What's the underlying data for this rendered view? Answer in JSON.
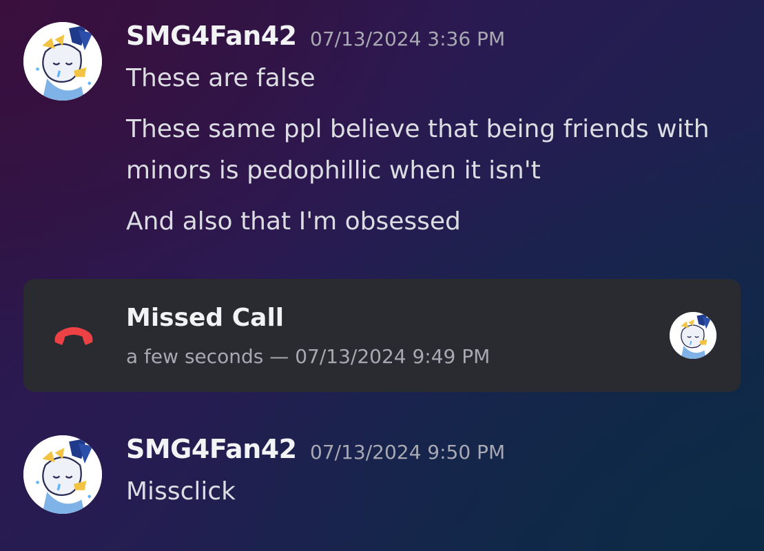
{
  "messages": [
    {
      "username": "SMG4Fan42",
      "timestamp": "07/13/2024 3:36 PM",
      "lines": [
        "These are false",
        "These same ppl believe that being friends with minors is pedophillic when it isn't",
        "And also that I'm obsessed"
      ]
    },
    {
      "username": "SMG4Fan42",
      "timestamp": "07/13/2024 9:50 PM",
      "lines": [
        "Missclick"
      ]
    }
  ],
  "call": {
    "title": "Missed Call",
    "subtitle": "a few seconds — 07/13/2024 9:49 PM",
    "icon": "phone-hangup-icon",
    "icon_color": "#ed4245"
  },
  "colors": {
    "username": "#f2f3f5",
    "timestamp": "#a8a9b3",
    "message": "#dcdde3",
    "card_bg": "#2a2b30"
  }
}
